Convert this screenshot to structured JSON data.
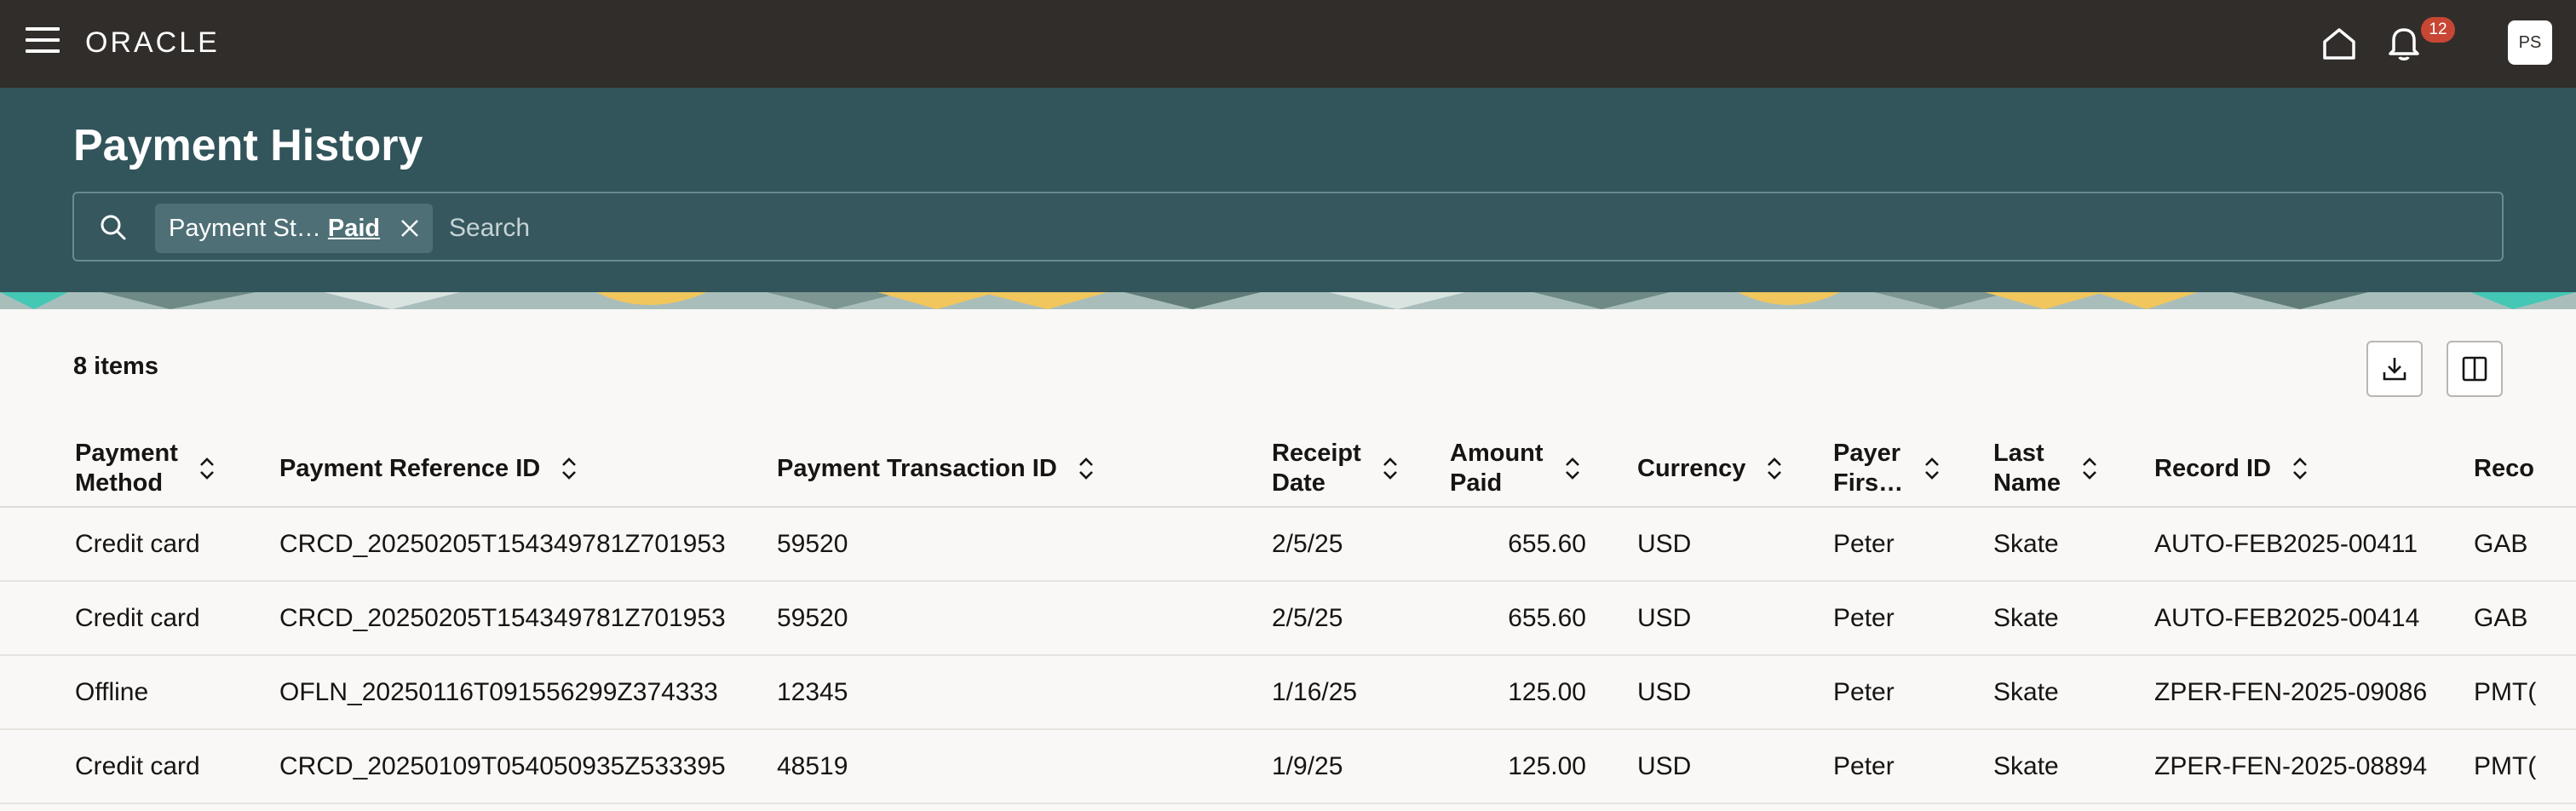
{
  "topbar": {
    "logo": "ORACLE",
    "notification_count": "12",
    "avatar_initials": "PS"
  },
  "header": {
    "title": "Payment History",
    "filter_chip": {
      "label": "Payment St…",
      "value": "Paid"
    },
    "search_placeholder": "Search"
  },
  "content": {
    "items_count": "8 items"
  },
  "table": {
    "columns": [
      [
        "Payment",
        "Method"
      ],
      [
        "Payment Reference ID"
      ],
      [
        "Payment Transaction ID"
      ],
      [
        "Receipt",
        "Date"
      ],
      [
        "Amount",
        "Paid"
      ],
      [
        "Currency"
      ],
      [
        "Payer",
        "Firs…"
      ],
      [
        "Last",
        "Name"
      ],
      [
        "Record ID"
      ],
      [
        "Reco"
      ]
    ],
    "rows": [
      [
        "Credit card",
        "CRCD_20250205T154349781Z701953",
        "59520",
        "2/5/25",
        "655.60",
        "USD",
        "Peter",
        "Skate",
        "AUTO-FEB2025-00411",
        "GAB"
      ],
      [
        "Credit card",
        "CRCD_20250205T154349781Z701953",
        "59520",
        "2/5/25",
        "655.60",
        "USD",
        "Peter",
        "Skate",
        "AUTO-FEB2025-00414",
        "GAB"
      ],
      [
        "Offline",
        "OFLN_20250116T091556299Z374333",
        "12345",
        "1/16/25",
        "125.00",
        "USD",
        "Peter",
        "Skate",
        "ZPER-FEN-2025-09086",
        "PMT("
      ],
      [
        "Credit card",
        "CRCD_20250109T054050935Z533395",
        "48519",
        "1/9/25",
        "125.00",
        "USD",
        "Peter",
        "Skate",
        "ZPER-FEN-2025-08894",
        "PMT("
      ]
    ]
  },
  "colors": {
    "topbar": "#312d2a",
    "header": "#32545b",
    "badge": "#c74634",
    "page_bg": "#f9f8f6"
  }
}
